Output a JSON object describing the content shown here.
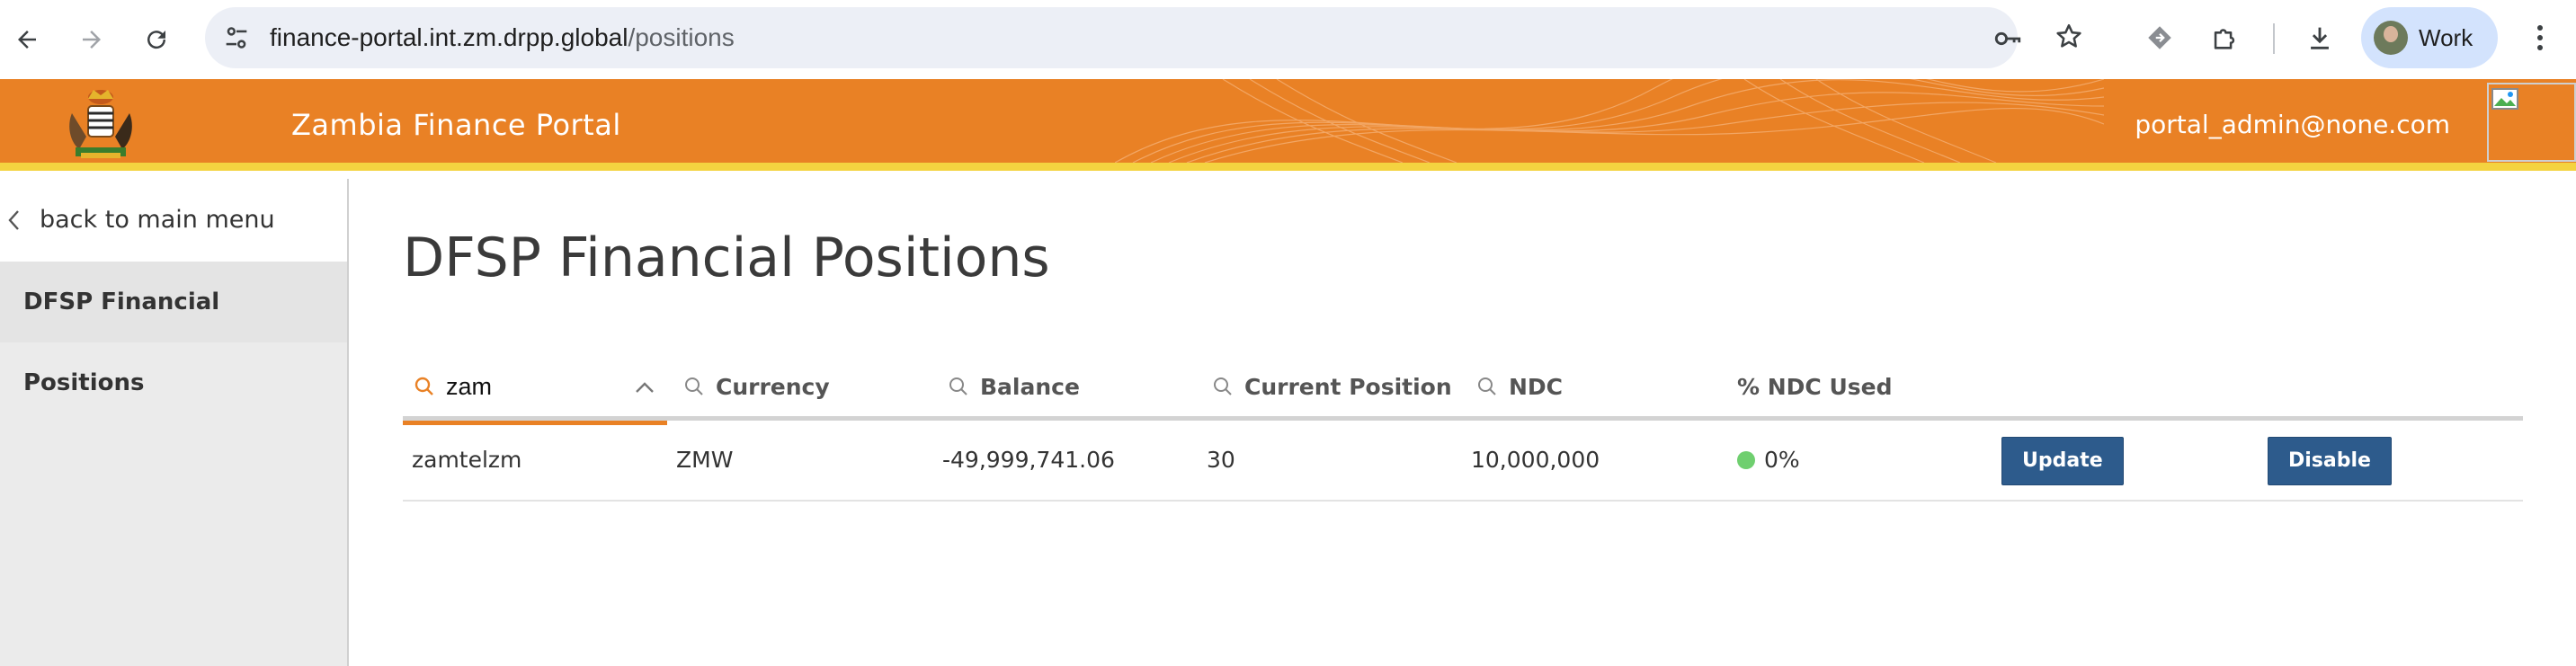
{
  "browser": {
    "url_host": "finance-portal.int.zm.drpp.global",
    "url_path": "/positions",
    "profile_label": "Work"
  },
  "header": {
    "title": "Zambia Finance Portal",
    "user_email": "portal_admin@none.com",
    "color": "#e98125",
    "accent_bar_color": "#f4d340"
  },
  "sidebar": {
    "back_label": "back to main menu",
    "items": [
      {
        "label": "DFSP Financial Positions",
        "active": true
      }
    ]
  },
  "main": {
    "title": "DFSP Financial Positions",
    "table": {
      "filter_value": "zam",
      "columns": [
        {
          "label": "Currency"
        },
        {
          "label": "Balance"
        },
        {
          "label": "Current Position"
        },
        {
          "label": "NDC"
        },
        {
          "label": "% NDC Used"
        }
      ],
      "rows": [
        {
          "dfsp": "zamtelzm",
          "currency": "ZMW",
          "balance": "-49,999,741.06",
          "current_position": "30",
          "ndc": "10,000,000",
          "ndc_used": "0%",
          "status_color": "#6fcf6f",
          "update_label": "Update",
          "disable_label": "Disable"
        }
      ]
    }
  }
}
